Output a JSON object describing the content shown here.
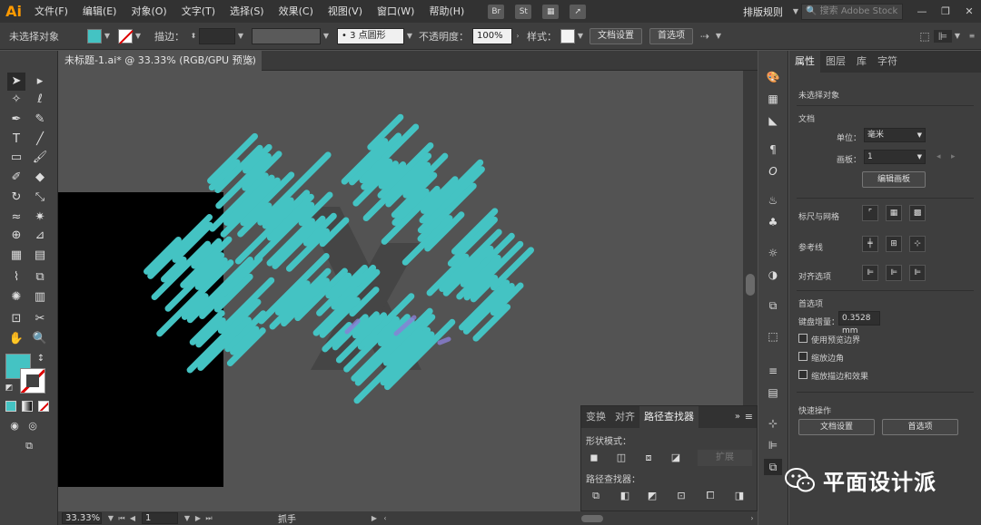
{
  "app": {
    "logo": "Ai"
  },
  "menu": [
    "文件(F)",
    "编辑(E)",
    "对象(O)",
    "文字(T)",
    "选择(S)",
    "效果(C)",
    "视图(V)",
    "窗口(W)",
    "帮助(H)"
  ],
  "menubar_icons": [
    {
      "name": "bridge-icon",
      "glyph": "Br"
    },
    {
      "name": "stock-icon",
      "glyph": "St"
    }
  ],
  "workspace": "排版规则",
  "search_stock": "搜索 Adobe Stock",
  "control": {
    "selection": "未选择对象",
    "fill_color": "#44c3c3",
    "stroke_label": "描边：",
    "stroke_value": "",
    "brush": "• 3 点圆形",
    "opacity_label": "不透明度：",
    "opacity_value": "100%",
    "style_label": "样式：",
    "doc_setup": "文档设置",
    "prefs": "首选项"
  },
  "doc_tab": {
    "title": "未标题-1.ai* @ 33.33% (RGB/GPU 预览)",
    "close": "×"
  },
  "status": {
    "zoom": "33.33%",
    "artboard": "1",
    "tool": "抓手"
  },
  "panel": {
    "tabs": [
      "属性",
      "图层",
      "库",
      "字符"
    ],
    "active_tab": "属性",
    "no_selection": "未选择对象",
    "document": "文档",
    "units_label": "单位：",
    "units_value": "毫米",
    "artboard_label": "画板：",
    "artboard_value": "1",
    "edit_artboards": "编辑画板",
    "rulers_grids": "标尺与网格",
    "guides": "参考线",
    "align_options": "对齐选项",
    "preferences": "首选项",
    "keyboard_increment": "键盘增量：",
    "keyboard_value": "0.3528",
    "keyboard_unit": "mm",
    "checks": [
      "使用预览边界",
      "缩放边角",
      "缩放描边和效果"
    ],
    "quick_actions": "快速操作",
    "qa_doc_setup": "文档设置",
    "qa_prefs": "首选项"
  },
  "pathfinder": {
    "tabs": [
      "变换",
      "对齐",
      "路径查找器"
    ],
    "active_tab": "路径查找器",
    "shape_modes": "形状模式：",
    "expand": "扩展",
    "pathfinders": "路径查找器："
  },
  "watermark": "平面设计派",
  "colors": {
    "accent": "#44c3c3",
    "artboard": "#000000",
    "canvas": "#535353"
  }
}
